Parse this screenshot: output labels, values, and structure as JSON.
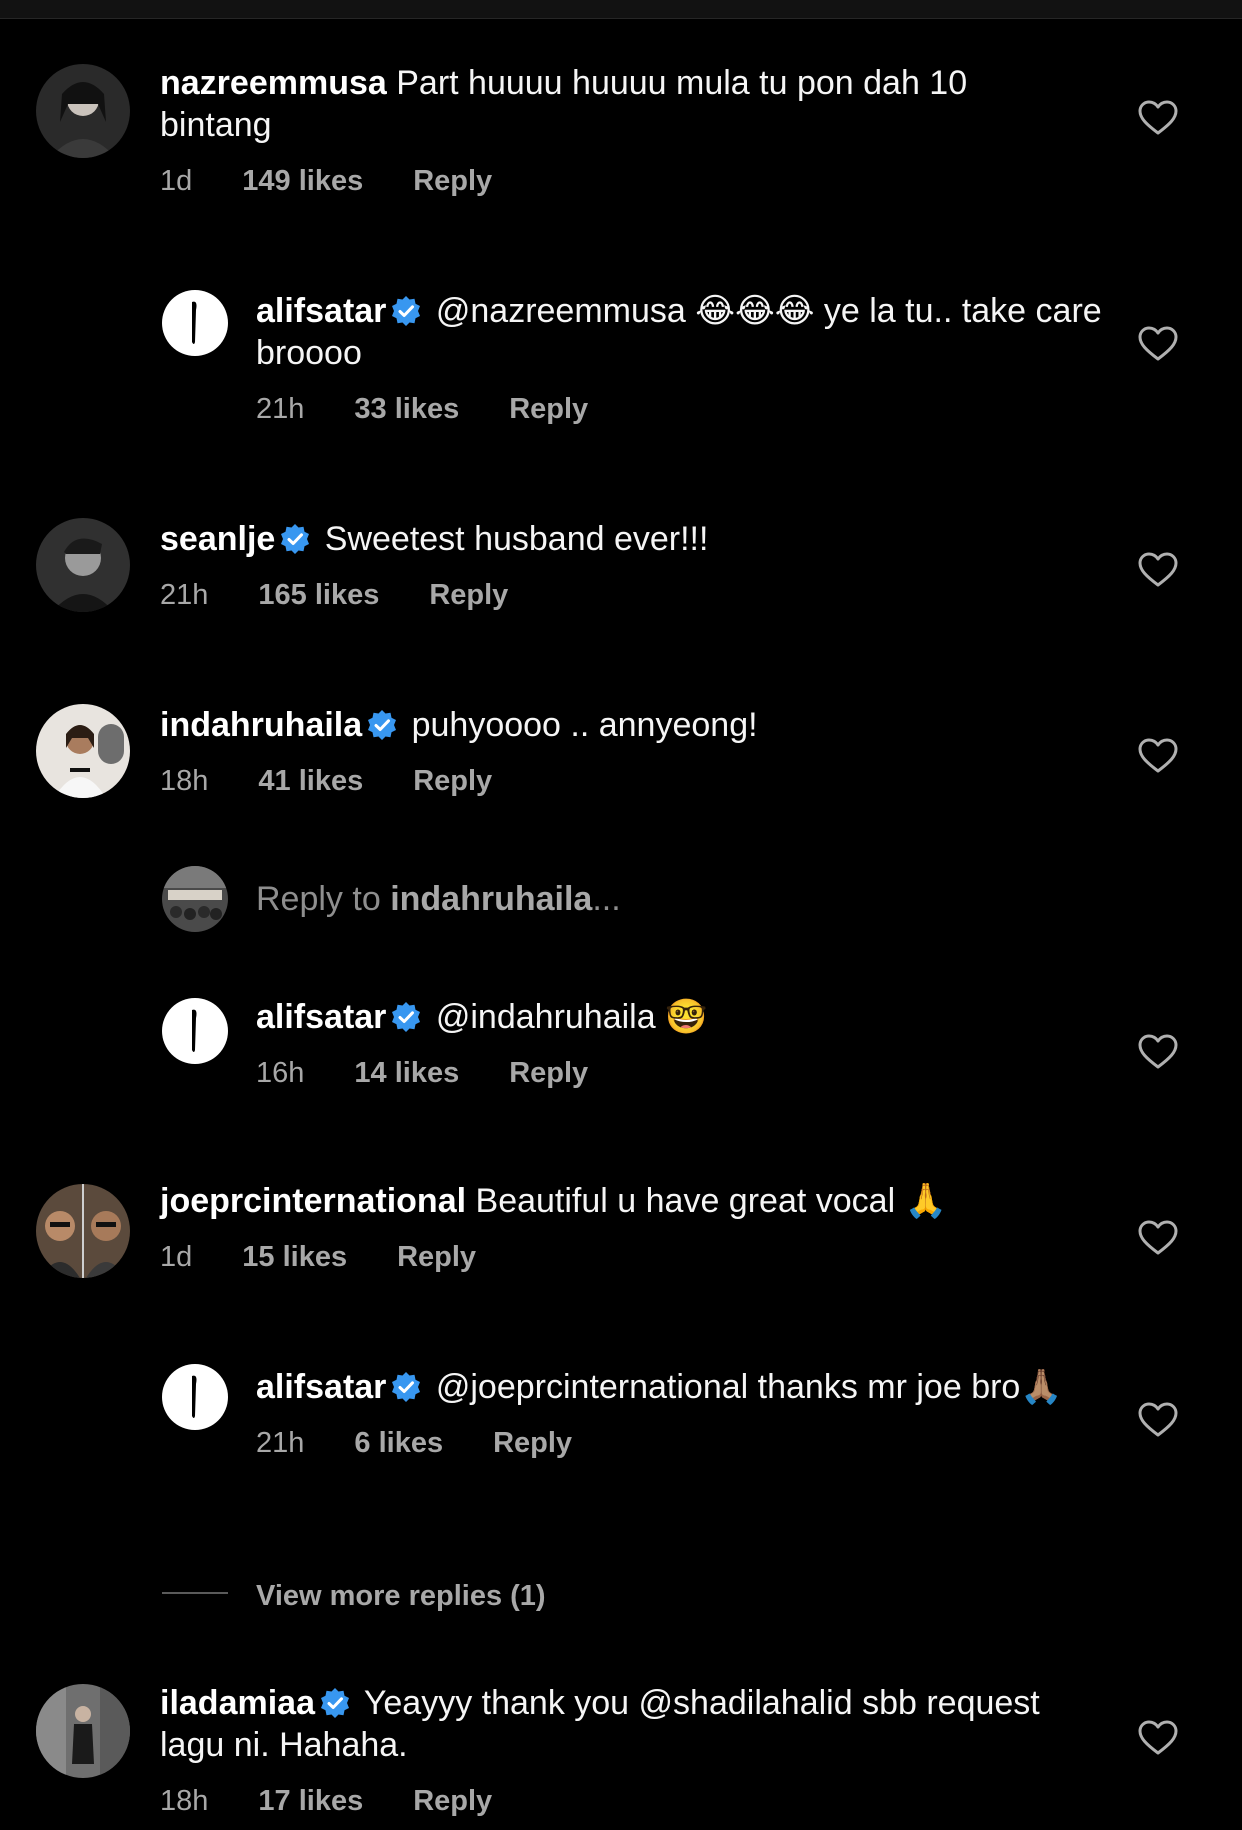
{
  "comments": [
    {
      "username": "nazreemmusa",
      "verified": false,
      "text": "Part huuuu huuuu mula tu pon dah 10 bintang",
      "time": "1d",
      "likes": "149 likes",
      "reply": "Reply"
    },
    {
      "username": "alifsatar",
      "verified": true,
      "text": "@nazreemmusa 😂😂😂 ye la tu.. take care broooo",
      "time": "21h",
      "likes": "33 likes",
      "reply": "Reply"
    },
    {
      "username": "seanlje",
      "verified": true,
      "text": "Sweetest husband ever!!!",
      "time": "21h",
      "likes": "165 likes",
      "reply": "Reply"
    },
    {
      "username": "indahruhaila",
      "verified": true,
      "text": "puhyoooo .. annyeong!",
      "time": "18h",
      "likes": "41 likes",
      "reply": "Reply"
    },
    {
      "username": "alifsatar",
      "verified": true,
      "text": "@indahruhaila 🤓",
      "time": "16h",
      "likes": "14 likes",
      "reply": "Reply"
    },
    {
      "username": "joeprcinternational",
      "verified": false,
      "text": "Beautiful u have great vocal 🙏",
      "time": "1d",
      "likes": "15 likes",
      "reply": "Reply"
    },
    {
      "username": "alifsatar",
      "verified": true,
      "text": "@joeprcinternational thanks mr joe bro🙏🏽",
      "time": "21h",
      "likes": "6 likes",
      "reply": "Reply"
    },
    {
      "username": "iladamiaa",
      "verified": true,
      "text": "Yeayyy thank you @shadilahalid sbb request lagu ni. Hahaha.",
      "time": "18h",
      "likes": "17 likes",
      "reply": "Reply"
    }
  ],
  "reply_to": {
    "prefix": "Reply to ",
    "username": "indahruhaila",
    "suffix": "..."
  },
  "view_more": "View more replies (1)",
  "colors": {
    "background": "#000000",
    "secondary_text": "#a8a8a8",
    "verified_blue": "#3897f0"
  },
  "icons": {
    "like": "heart-outline-icon",
    "verified": "verified-badge-icon"
  }
}
